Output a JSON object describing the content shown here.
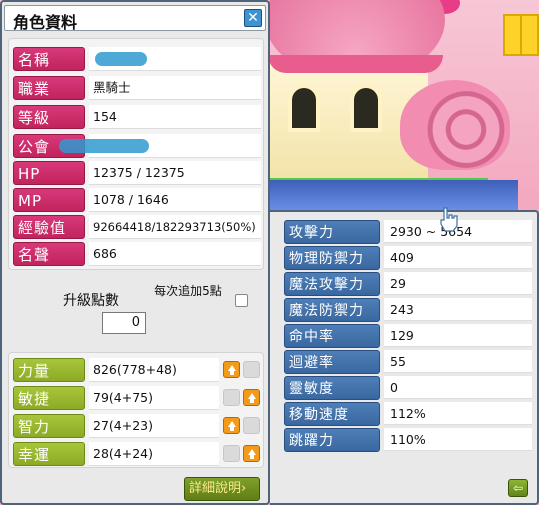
{
  "window": {
    "title": "角色資料",
    "close_icon": "close-x-icon"
  },
  "basic_info": [
    {
      "label": "名稱",
      "value": "",
      "redacted": true
    },
    {
      "label": "職業",
      "value": "黑騎士"
    },
    {
      "label": "等級",
      "value": "154"
    },
    {
      "label": "公會",
      "value": "",
      "redacted": true
    },
    {
      "label": "HP",
      "value": "12375 / 12375"
    },
    {
      "label": "MP",
      "value": "1078 / 1646"
    },
    {
      "label": "經驗值",
      "value": "92664418/182293713(50%)"
    },
    {
      "label": "名聲",
      "value": "686"
    }
  ],
  "ability_points": {
    "label": "升級點數",
    "value": "0",
    "auto_add_label": "每次追加5點",
    "auto_add_checked": false
  },
  "stats": [
    {
      "label": "力量",
      "value": "826(778+48)",
      "up_enabled": true,
      "alt_enabled": false
    },
    {
      "label": "敏捷",
      "value": "79(4+75)",
      "up_enabled": false,
      "alt_enabled": true
    },
    {
      "label": "智力",
      "value": "27(4+23)",
      "up_enabled": true,
      "alt_enabled": false
    },
    {
      "label": "幸運",
      "value": "28(4+24)",
      "up_enabled": false,
      "alt_enabled": true
    }
  ],
  "detail_button": {
    "label": "詳細說明",
    "arrow": "›"
  },
  "detail_stats": [
    {
      "label": "攻擊力",
      "value": "2930 ~ 5654"
    },
    {
      "label": "物理防禦力",
      "value": "409"
    },
    {
      "label": "魔法攻擊力",
      "value": "29"
    },
    {
      "label": "魔法防禦力",
      "value": "243"
    },
    {
      "label": "命中率",
      "value": "129"
    },
    {
      "label": "迴避率",
      "value": "55"
    },
    {
      "label": "靈敏度",
      "value": "0"
    },
    {
      "label": "移動速度",
      "value": "112%"
    },
    {
      "label": "跳躍力",
      "value": "110%"
    }
  ],
  "back_button": {
    "icon": "back-arrow-icon",
    "glyph": "⇦"
  },
  "colors": {
    "basic_label": "#c82a66",
    "stat_label": "#9ab82f",
    "detail_label": "#3f6fa8",
    "up_button": "#f39a1b"
  }
}
